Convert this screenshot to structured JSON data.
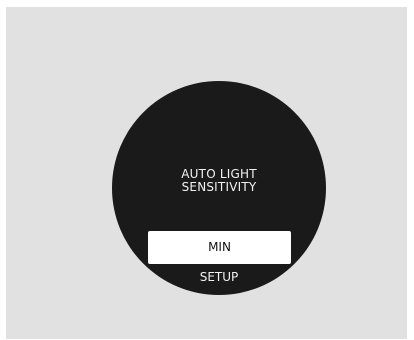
{
  "display": {
    "title_line1": "AUTO LIGHT",
    "title_line2": "SENSITIVITY",
    "selected_option": "MIN",
    "footer_label": "SETUP"
  },
  "colors": {
    "background": "#e1e1e1",
    "dial": "#1a1a1a",
    "highlight": "#ffffff",
    "text_light": "#f2f2f2",
    "text_dark": "#111111"
  }
}
